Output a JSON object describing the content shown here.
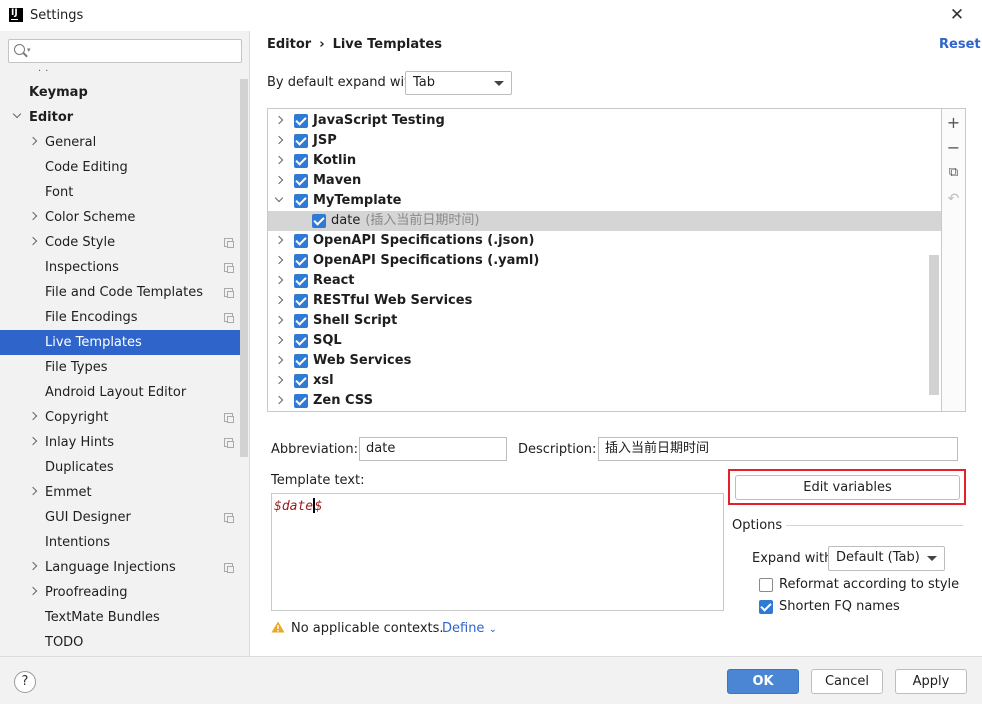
{
  "window": {
    "title": "Settings",
    "logo": "IJ"
  },
  "sidebar": {
    "search_placeholder": "",
    "items": [
      {
        "label": "Keymap",
        "level": 0,
        "bold": true,
        "expander": "none"
      },
      {
        "label": "Editor",
        "level": 0,
        "bold": true,
        "expander": "down"
      },
      {
        "label": "General",
        "level": 1,
        "expander": "right"
      },
      {
        "label": "Code Editing",
        "level": 1,
        "expander": "none"
      },
      {
        "label": "Font",
        "level": 1,
        "expander": "none"
      },
      {
        "label": "Color Scheme",
        "level": 1,
        "expander": "right"
      },
      {
        "label": "Code Style",
        "level": 1,
        "expander": "right",
        "project_icon": true
      },
      {
        "label": "Inspections",
        "level": 1,
        "expander": "none",
        "project_icon": true
      },
      {
        "label": "File and Code Templates",
        "level": 1,
        "expander": "none",
        "project_icon": true
      },
      {
        "label": "File Encodings",
        "level": 1,
        "expander": "none",
        "project_icon": true
      },
      {
        "label": "Live Templates",
        "level": 1,
        "expander": "none",
        "selected": true
      },
      {
        "label": "File Types",
        "level": 1,
        "expander": "none"
      },
      {
        "label": "Android Layout Editor",
        "level": 1,
        "expander": "none"
      },
      {
        "label": "Copyright",
        "level": 1,
        "expander": "right",
        "project_icon": true
      },
      {
        "label": "Inlay Hints",
        "level": 1,
        "expander": "right",
        "project_icon": true
      },
      {
        "label": "Duplicates",
        "level": 1,
        "expander": "none"
      },
      {
        "label": "Emmet",
        "level": 1,
        "expander": "right"
      },
      {
        "label": "GUI Designer",
        "level": 1,
        "expander": "none",
        "project_icon": true
      },
      {
        "label": "Intentions",
        "level": 1,
        "expander": "none"
      },
      {
        "label": "Language Injections",
        "level": 1,
        "expander": "right",
        "project_icon": true
      },
      {
        "label": "Proofreading",
        "level": 1,
        "expander": "right"
      },
      {
        "label": "TextMate Bundles",
        "level": 1,
        "expander": "none"
      },
      {
        "label": "TODO",
        "level": 1,
        "expander": "none"
      }
    ]
  },
  "header": {
    "breadcrumb": [
      "Editor",
      "Live Templates"
    ],
    "reset_label": "Reset"
  },
  "expand_default": {
    "label": "By default expand with",
    "value": "Tab"
  },
  "templates": [
    {
      "name": "JavaScript Testing",
      "checked": true,
      "expander": "right"
    },
    {
      "name": "JSP",
      "checked": true,
      "expander": "right"
    },
    {
      "name": "Kotlin",
      "checked": true,
      "expander": "right"
    },
    {
      "name": "Maven",
      "checked": true,
      "expander": "right"
    },
    {
      "name": "MyTemplate",
      "checked": true,
      "expander": "down"
    },
    {
      "name": "date",
      "desc": "(插入当前日期时间)",
      "checked": true,
      "child": true,
      "selected": true
    },
    {
      "name": "OpenAPI Specifications (.json)",
      "checked": true,
      "expander": "right"
    },
    {
      "name": "OpenAPI Specifications (.yaml)",
      "checked": true,
      "expander": "right"
    },
    {
      "name": "React",
      "checked": true,
      "expander": "right"
    },
    {
      "name": "RESTful Web Services",
      "checked": true,
      "expander": "right"
    },
    {
      "name": "Shell Script",
      "checked": true,
      "expander": "right"
    },
    {
      "name": "SQL",
      "checked": true,
      "expander": "right"
    },
    {
      "name": "Web Services",
      "checked": true,
      "expander": "right"
    },
    {
      "name": "xsl",
      "checked": true,
      "expander": "right"
    },
    {
      "name": "Zen CSS",
      "checked": true,
      "expander": "right"
    }
  ],
  "toolbar": {
    "add": "+",
    "remove": "−",
    "copy": "⧉",
    "restore": "↶"
  },
  "form": {
    "abbreviation_label": "Abbreviation:",
    "abbreviation_value": "date",
    "description_label": "Description:",
    "description_value": "插入当前日期时间",
    "template_text_label": "Template text:",
    "template_text_before_cursor": "$date",
    "template_text_after_cursor": "$",
    "edit_variables_label": "Edit variables",
    "options_title": "Options",
    "expand_with_label": "Expand with",
    "expand_with_value": "Default (Tab)",
    "reformat_label": "Reformat according to style",
    "reformat_checked": false,
    "shorten_label": "Shorten FQ names",
    "shorten_checked": true,
    "context_warning": "No applicable contexts.",
    "define_label": "Define"
  },
  "footer": {
    "help": "?",
    "ok": "OK",
    "cancel": "Cancel",
    "apply": "Apply"
  },
  "colors": {
    "accent": "#2f65ca",
    "checkbox": "#2f7ad4",
    "highlight_border": "#e4202a"
  }
}
